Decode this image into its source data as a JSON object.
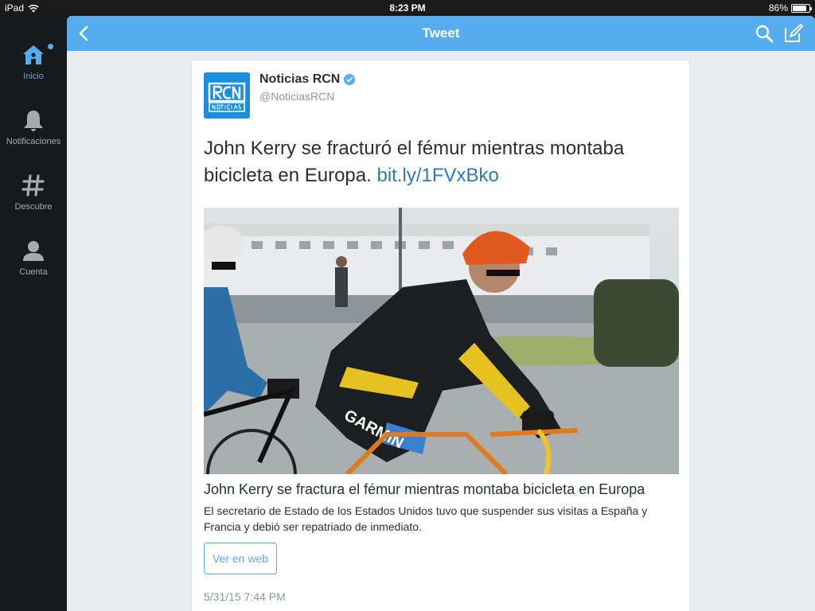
{
  "status_bar": {
    "device": "iPad",
    "time": "8:23 PM",
    "battery_percent": "86%",
    "battery_level": 0.86
  },
  "sidebar": {
    "items": [
      {
        "label": "Inicio",
        "icon": "home-icon",
        "active": true
      },
      {
        "label": "Notificaciones",
        "icon": "bell-icon",
        "active": false
      },
      {
        "label": "Descubre",
        "icon": "hashtag-icon",
        "active": false
      },
      {
        "label": "Cuenta",
        "icon": "person-icon",
        "active": false
      }
    ]
  },
  "navbar": {
    "title": "Tweet",
    "icons": [
      "back-chevron-icon",
      "search-icon",
      "compose-icon"
    ]
  },
  "tweet": {
    "author_name": "Noticias RCN",
    "author_handle": "@NoticiasRCN",
    "avatar_logo_text": "RCN NOTICIAS",
    "verified": true,
    "text": "John Kerry se fracturó el fémur mientras montaba bicicleta en Europa.",
    "link_text": "bit.ly/1FVxBko",
    "card": {
      "title": "John Kerry se fractura el fémur mientras montaba bicicleta en Europa",
      "description": "El secretario de Estado de los Estados Unidos tuvo que suspender sus visitas a España y Francia y debió ser repatriado de inmediato.",
      "button_label": "Ver en web"
    },
    "timestamp": "5/31/15 7:44 PM"
  },
  "colors": {
    "accent": "#55acee",
    "sidebar_bg": "#171a1c",
    "link": "#2b7bb9"
  }
}
